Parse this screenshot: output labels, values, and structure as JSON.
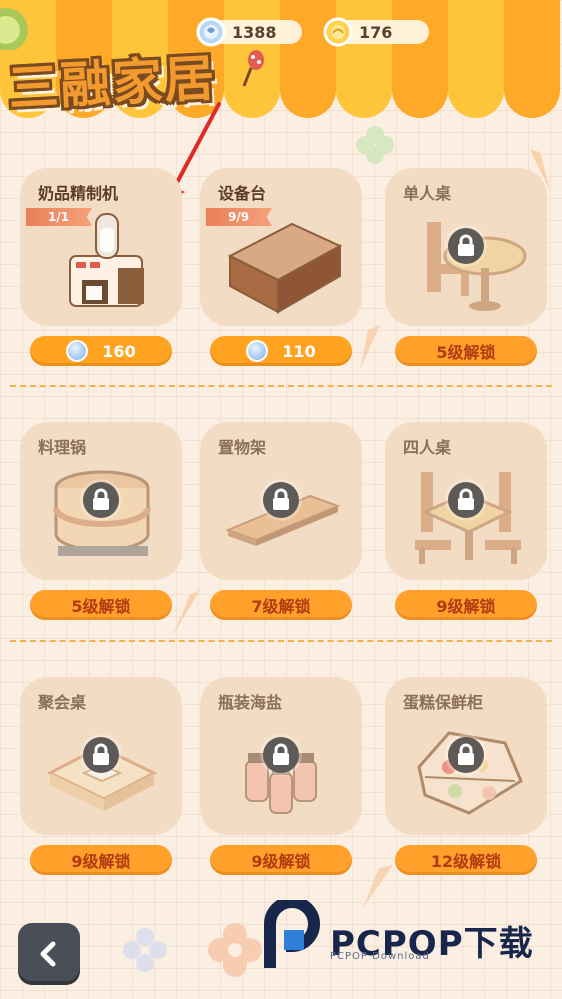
{
  "header": {
    "title": "三融家居",
    "currency_gem": "1388",
    "currency_coin": "176"
  },
  "rows": [
    [
      {
        "name": "奶品精制机",
        "count": "1/1",
        "price": "160",
        "locked": false
      },
      {
        "name": "设备台",
        "count": "9/9",
        "price": "110",
        "locked": false
      },
      {
        "name": "单人桌",
        "unlock": "5级解锁",
        "locked": true
      }
    ],
    [
      {
        "name": "料理锅",
        "unlock": "5级解锁",
        "locked": true
      },
      {
        "name": "置物架",
        "unlock": "7级解锁",
        "locked": true
      },
      {
        "name": "四人桌",
        "unlock": "9级解锁",
        "locked": true
      }
    ],
    [
      {
        "name": "聚会桌",
        "unlock": "9级解锁",
        "locked": true
      },
      {
        "name": "瓶装海盐",
        "unlock": "9级解锁",
        "locked": true
      },
      {
        "name": "蛋糕保鲜柜",
        "unlock": "12级解锁",
        "locked": true
      }
    ]
  ],
  "watermark": {
    "brand": "PCPOP下载",
    "sub": "PCPOP Download"
  },
  "colors": {
    "accent": "#ffa321",
    "background": "#fbeee2",
    "card": "#f3dcc4"
  },
  "icons": {
    "back": "chevron-left-icon",
    "lock": "lock-icon",
    "gem": "gem-icon",
    "coin": "coin-icon"
  }
}
